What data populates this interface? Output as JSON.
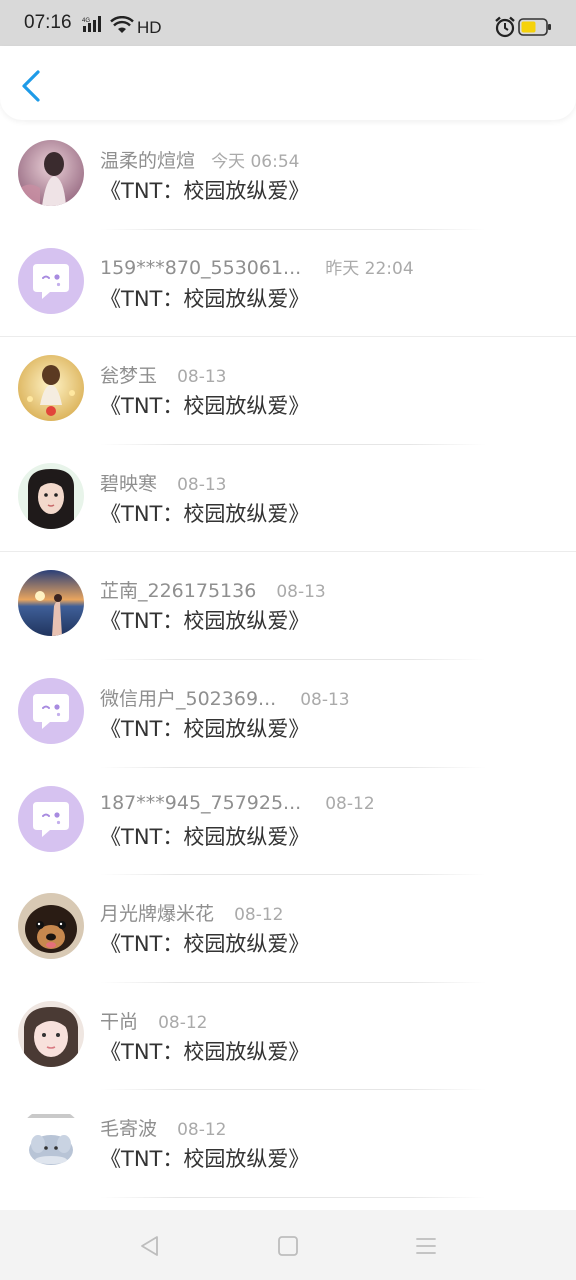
{
  "status_bar": {
    "time": "07:16",
    "network": "4G",
    "hd": "HD",
    "battery_color": "#f5d20b"
  },
  "nav": {
    "back_icon": "chevron-left-icon",
    "accent": "#1e9be8"
  },
  "items": [
    {
      "name": "温柔的煊煊",
      "time": "今天 06:54",
      "message": "《TNT：校园放纵爱》",
      "avatar": "photo-girl-pink"
    },
    {
      "name": "159***870_553061...",
      "time": "昨天 22:04",
      "message": "《TNT：校园放纵爱》",
      "avatar": "default-chat-avatar"
    },
    {
      "name": "瓮梦玉",
      "time": "08-13",
      "message": "《TNT：校园放纵爱》",
      "avatar": "photo-girl-yellow"
    },
    {
      "name": "碧映寒",
      "time": "08-13",
      "message": "《TNT：校园放纵爱》",
      "avatar": "photo-girl-portrait"
    },
    {
      "name": "芷南_226175136",
      "time": "08-13",
      "message": "《TNT：校园放纵爱》",
      "avatar": "photo-sunset-sea"
    },
    {
      "name": "微信用户_502369...",
      "time": "08-13",
      "message": "《TNT：校园放纵爱》",
      "avatar": "default-chat-avatar"
    },
    {
      "name": "187***945_757925...",
      "time": "08-12",
      "message": "《TNT：校园放纵爱》",
      "avatar": "default-chat-avatar"
    },
    {
      "name": "月光牌爆米花",
      "time": "08-12",
      "message": "《TNT：校园放纵爱》",
      "avatar": "photo-dog"
    },
    {
      "name": "干尚",
      "time": "08-12",
      "message": "《TNT：校园放纵爱》",
      "avatar": "photo-girl-face"
    },
    {
      "name": "毛寄波",
      "time": "08-12",
      "message": "《TNT：校园放纵爱》",
      "avatar": "cartoon-elephant"
    }
  ],
  "bottom_nav": {
    "back": "triangle-back-icon",
    "home": "square-home-icon",
    "menu": "menu-lines-icon"
  }
}
